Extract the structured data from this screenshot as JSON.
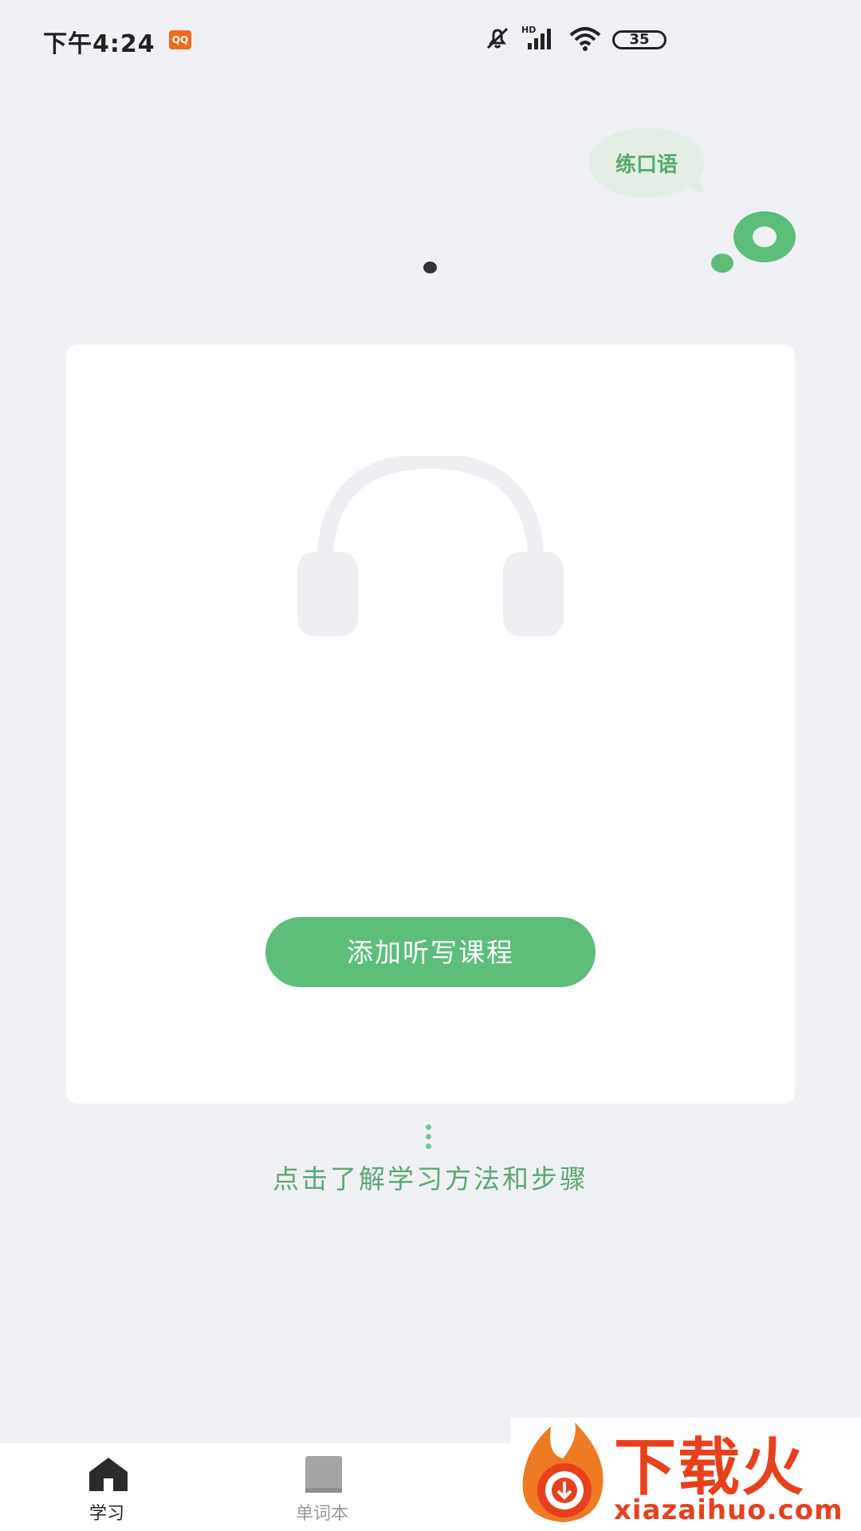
{
  "status_bar": {
    "time": "下午4:24",
    "app_badge": "QQ",
    "network": "HD",
    "battery": "35"
  },
  "bubble": {
    "label": "练口语"
  },
  "card": {
    "cta_label": "添加听写课程"
  },
  "learn_link": "点击了解学习方法和步骤",
  "bottom_nav": {
    "items": [
      {
        "label": "学习",
        "icon": "home-icon",
        "active": true
      },
      {
        "label": "单词本",
        "icon": "book-icon",
        "active": false
      },
      {
        "label": "",
        "icon": "profile-icon",
        "active": false
      }
    ]
  },
  "watermark": {
    "title": "下载火",
    "url": "xiazaihuo.com"
  },
  "colors": {
    "accent": "#5dbe7a",
    "background": "#f0f1f5",
    "card": "#ffffff"
  }
}
